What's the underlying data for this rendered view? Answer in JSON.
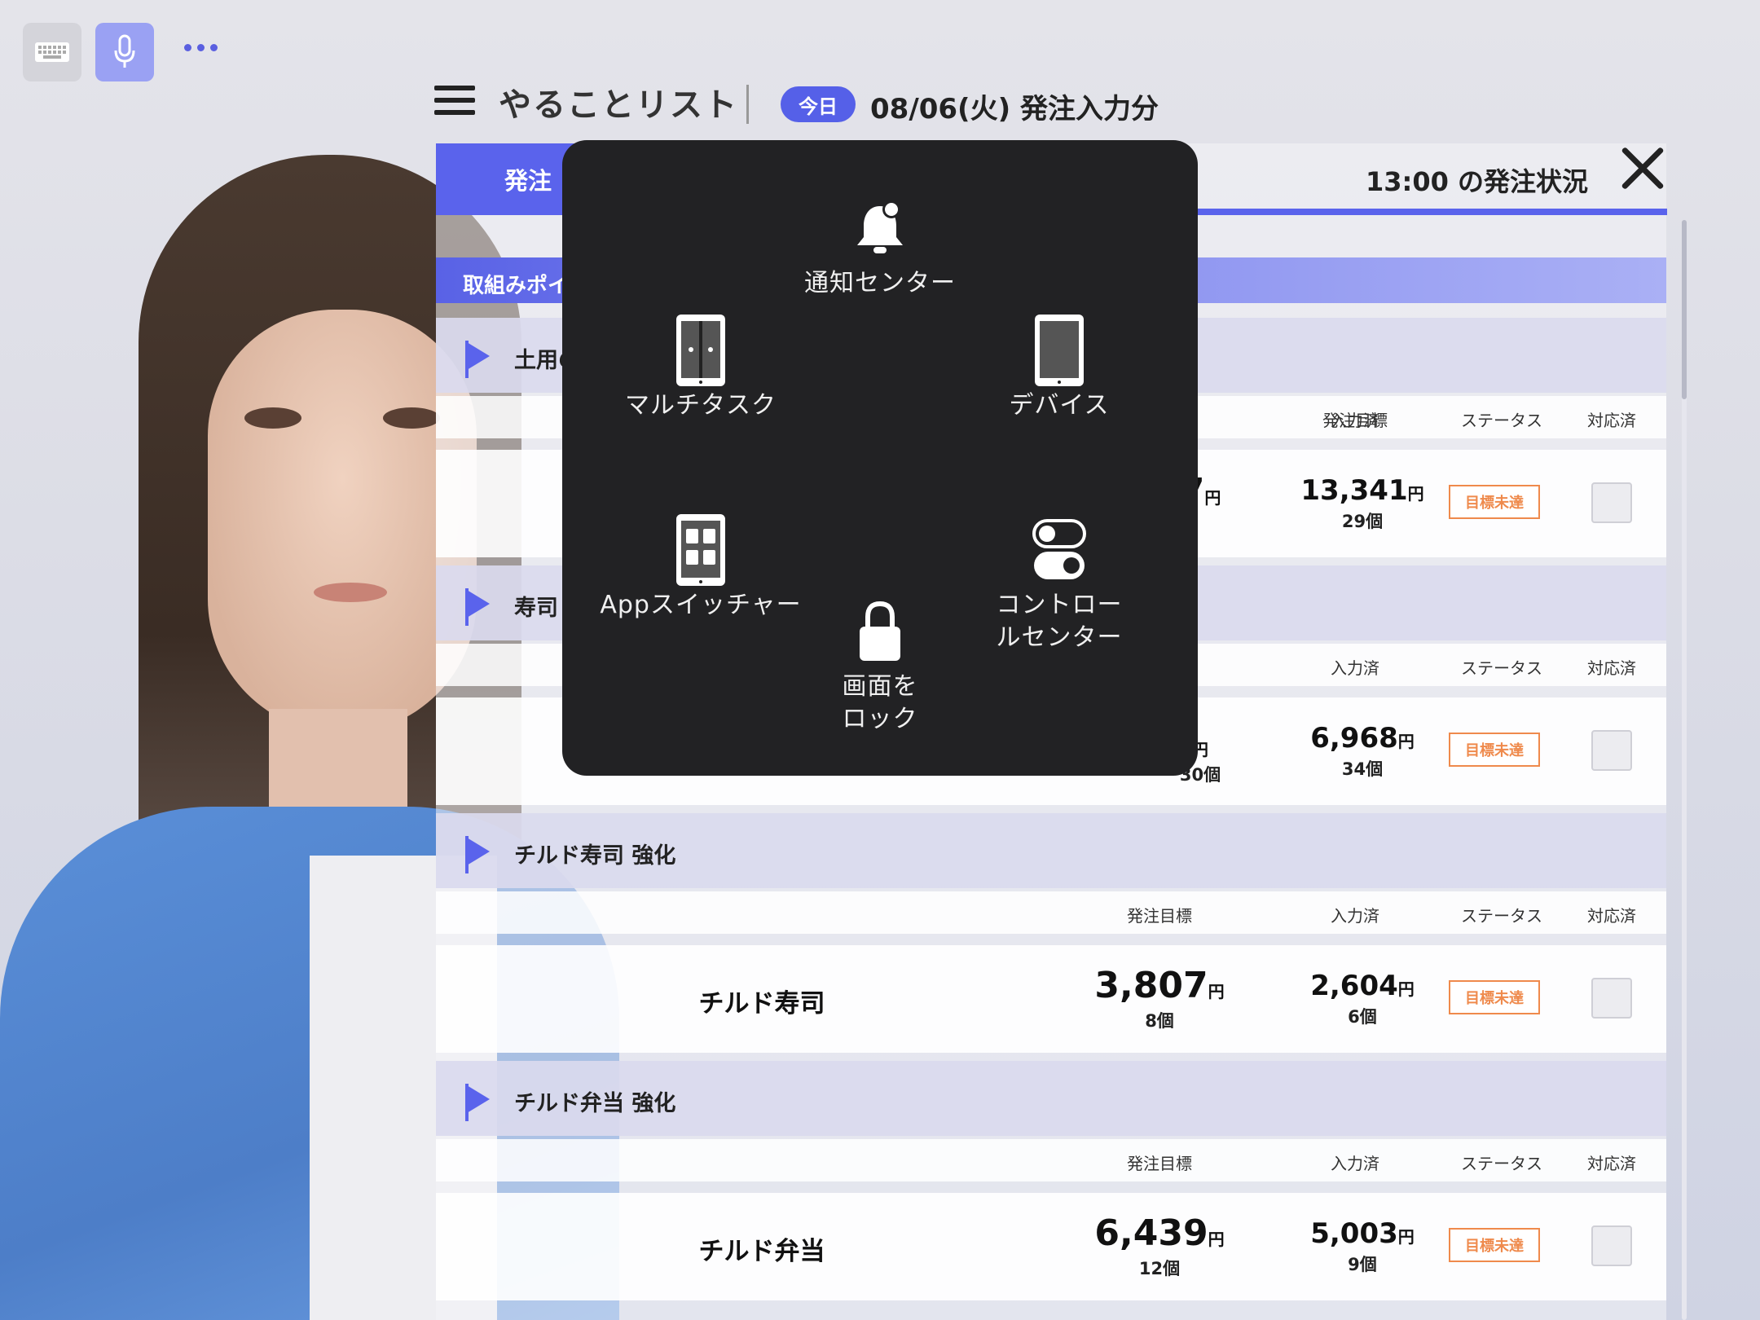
{
  "toolbar": {
    "keyboard_icon": "keyboard-icon",
    "mic_icon": "microphone-icon",
    "more_icon": "more-dots-icon"
  },
  "header": {
    "title": "やることリスト",
    "today_badge": "今日",
    "date_text": "08/06(火) 発注入力分"
  },
  "tabs": {
    "active_label": "発注",
    "status_time": "13:00 の発注状況"
  },
  "point_bar": {
    "label": "取組みポイ"
  },
  "columns": {
    "target": "発注目標",
    "entered": "入力済",
    "status": "ステータス",
    "done": "対応済"
  },
  "sections": [
    {
      "title": "土用の",
      "row": {
        "name": "",
        "target_value": "7",
        "target_unit": "円",
        "entered_value": "13,341",
        "entered_unit": "円",
        "entered_count": "29個",
        "status": "目標未達"
      }
    },
    {
      "title": "寿司",
      "row": {
        "name": "",
        "target_value": "",
        "target_unit": "円",
        "target_count": "30個",
        "entered_value": "6,968",
        "entered_unit": "円",
        "entered_count": "34個",
        "status": "目標未達"
      }
    },
    {
      "title": "チルド寿司 強化",
      "row": {
        "name": "チルド寿司",
        "target_value": "3,807",
        "target_unit": "円",
        "target_count": "8個",
        "entered_value": "2,604",
        "entered_unit": "円",
        "entered_count": "6個",
        "status": "目標未達"
      }
    },
    {
      "title": "チルド弁当 強化",
      "row": {
        "name": "チルド弁当",
        "target_value": "6,439",
        "target_unit": "円",
        "target_count": "12個",
        "entered_value": "5,003",
        "entered_unit": "円",
        "entered_count": "9個",
        "status": "目標未達"
      }
    }
  ],
  "assistive_menu": {
    "notification_center": "通知センター",
    "multitask": "マルチタスク",
    "device": "デバイス",
    "app_switcher": "Appスイッチャー",
    "control_center_1": "コントロー",
    "control_center_2": "ルセンター",
    "lock_screen_1": "画面を",
    "lock_screen_2": "ロック"
  },
  "colors": {
    "accent": "#5a63ec",
    "status_orange": "#ef8a4c",
    "menu_bg": "#222224"
  }
}
